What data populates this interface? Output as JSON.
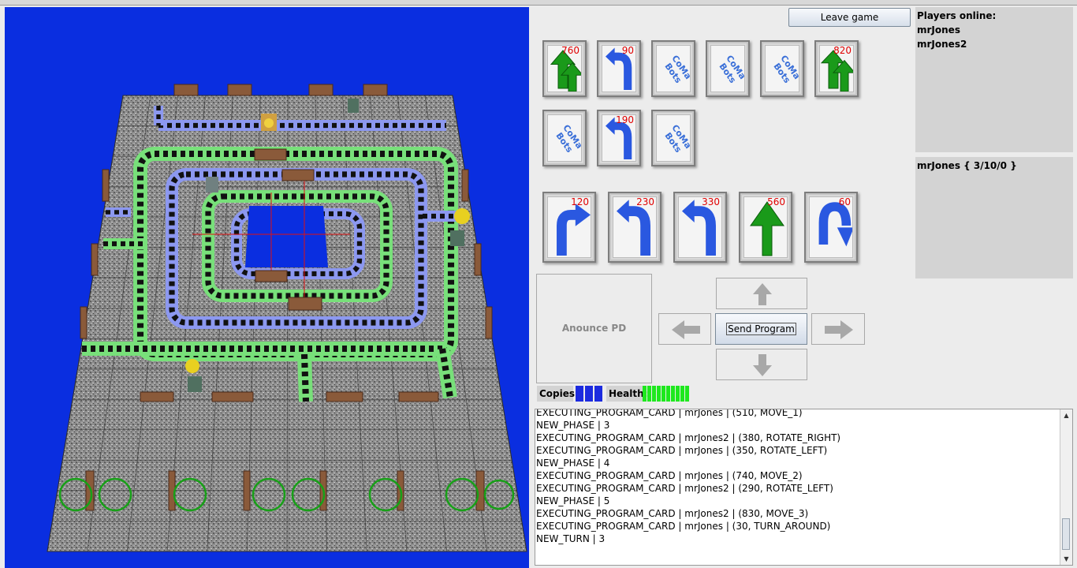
{
  "window": {
    "title": ""
  },
  "header": {
    "leave_label": "Leave game"
  },
  "players": {
    "title": "Players online:",
    "list": [
      "mrJones",
      "mrJones2"
    ]
  },
  "status": {
    "text": "mrJones  { 3/10/0 }"
  },
  "hand_cards": [
    {
      "priority": "760",
      "icon": "move-2-icon",
      "color": "#1a9a1a"
    },
    {
      "priority": "90",
      "icon": "u-turn-icon",
      "color": "#2a58e0"
    },
    {
      "priority": "",
      "icon": "card-back-logo",
      "logo": "CoMa Bots"
    },
    {
      "priority": "",
      "icon": "card-back-logo",
      "logo": "CoMa Bots"
    },
    {
      "priority": "",
      "icon": "card-back-logo",
      "logo": "CoMa Bots"
    },
    {
      "priority": "820",
      "icon": "move-3-icon",
      "color": "#1a9a1a"
    },
    {
      "priority": "",
      "icon": "card-back-logo",
      "logo": "CoMa Bots"
    },
    {
      "priority": "190",
      "icon": "u-turn-icon",
      "color": "#2a58e0"
    },
    {
      "priority": "",
      "icon": "card-back-logo",
      "logo": "CoMa Bots"
    }
  ],
  "program_cards": [
    {
      "priority": "120",
      "icon": "rotate-right-icon"
    },
    {
      "priority": "230",
      "icon": "u-turn-icon"
    },
    {
      "priority": "330",
      "icon": "u-turn-icon"
    },
    {
      "priority": "560",
      "icon": "move-1-icon"
    },
    {
      "priority": "60",
      "icon": "turn-around-icon"
    }
  ],
  "controls": {
    "announce_label": "Anounce PD",
    "send_label": "Send Program"
  },
  "copies": {
    "label": "Copies:",
    "count": 3,
    "color": "#1c2bdf"
  },
  "health": {
    "label": "Health:",
    "count": 10,
    "color": "#1ee81e"
  },
  "log": [
    "EXECUTING_PROGRAM_CARD | mrJones | (510, MOVE_1)",
    "NEW_PHASE | 3",
    "EXECUTING_PROGRAM_CARD | mrJones2 | (380, ROTATE_RIGHT)",
    "EXECUTING_PROGRAM_CARD | mrJones | (350, ROTATE_LEFT)",
    "NEW_PHASE | 4",
    "EXECUTING_PROGRAM_CARD | mrJones | (740, MOVE_2)",
    "EXECUTING_PROGRAM_CARD | mrJones2 | (290, ROTATE_LEFT)",
    "NEW_PHASE | 5",
    "EXECUTING_PROGRAM_CARD | mrJones2 | (830, MOVE_3)",
    "EXECUTING_PROGRAM_CARD | mrJones | (30, TURN_AROUND)",
    "NEW_TURN | 3"
  ]
}
